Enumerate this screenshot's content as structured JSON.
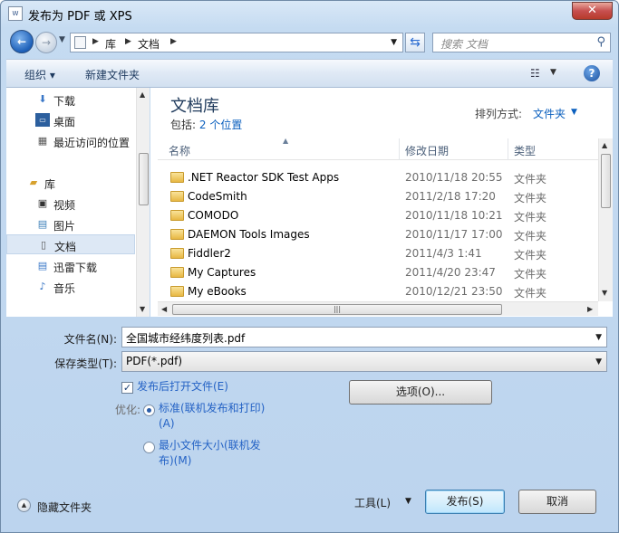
{
  "window": {
    "title": "发布为 PDF 或 XPS",
    "close_label": "✕"
  },
  "address": {
    "crumbs": [
      "库",
      "文档"
    ]
  },
  "search": {
    "placeholder": "搜索 文档"
  },
  "toolbar": {
    "organize": "组织 ▾",
    "new_folder": "新建文件夹"
  },
  "nav": {
    "items": [
      {
        "label": "下载",
        "icon": "download-icon"
      },
      {
        "label": "桌面",
        "icon": "desktop-icon"
      },
      {
        "label": "最近访问的位置",
        "icon": "recent-places-icon"
      },
      {
        "label": "库",
        "icon": "libraries-icon"
      },
      {
        "label": "视频",
        "icon": "video-icon"
      },
      {
        "label": "图片",
        "icon": "pictures-icon"
      },
      {
        "label": "文档",
        "icon": "documents-icon",
        "selected": true
      },
      {
        "label": "迅雷下载",
        "icon": "thunder-download-icon"
      },
      {
        "label": "音乐",
        "icon": "music-icon"
      }
    ]
  },
  "library": {
    "title": "文档库",
    "includes_label": "包括:",
    "includes_link": "2 个位置",
    "arrange_label": "排列方式:",
    "arrange_value": "文件夹"
  },
  "columns": {
    "name": "名称",
    "date": "修改日期",
    "type": "类型"
  },
  "files": [
    {
      "name": ".NET Reactor SDK Test Apps",
      "date": "2010/11/18 20:55",
      "type": "文件夹"
    },
    {
      "name": "CodeSmith",
      "date": "2011/2/18 17:20",
      "type": "文件夹"
    },
    {
      "name": "COMODO",
      "date": "2010/11/18 10:21",
      "type": "文件夹"
    },
    {
      "name": "DAEMON Tools Images",
      "date": "2010/11/17 17:00",
      "type": "文件夹"
    },
    {
      "name": "Fiddler2",
      "date": "2011/4/3 1:41",
      "type": "文件夹"
    },
    {
      "name": "My Captures",
      "date": "2011/4/20 23:47",
      "type": "文件夹"
    },
    {
      "name": "My eBooks",
      "date": "2010/12/21 23:50",
      "type": "文件夹"
    }
  ],
  "form": {
    "filename_label": "文件名(N):",
    "filename_value": "全国城市经纬度列表.pdf",
    "filetype_label": "保存类型(T):",
    "filetype_value": "PDF(*.pdf)",
    "open_after_label": "发布后打开文件(E)",
    "open_after_checked": true,
    "optimize_label": "优化:",
    "opt_standard": "标准(联机发布和打印)(A)",
    "opt_minimum": "最小文件大小(联机发布)(M)",
    "options_button": "选项(O)...",
    "hide_folders": "隐藏文件夹",
    "tools_label": "工具(L)",
    "publish_button": "发布(S)",
    "cancel_button": "取消"
  }
}
